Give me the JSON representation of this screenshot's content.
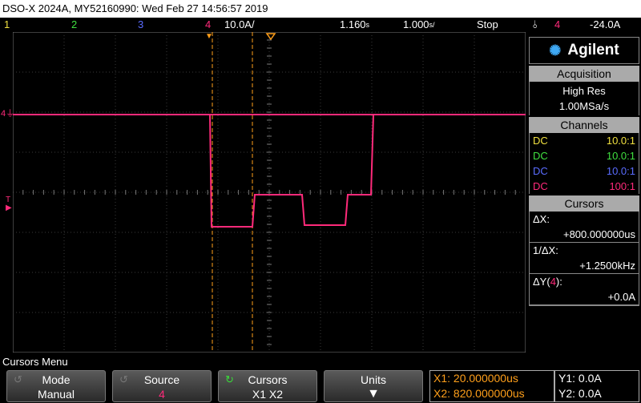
{
  "title": "DSO-X 2024A, MY52160990: Wed Feb 27 14:56:57 2019",
  "status": {
    "ch1": "1",
    "ch2": "2",
    "ch3": "3",
    "ch4": "4",
    "ch4_scale": "10.0A/",
    "time_delay": "1.160",
    "time_delay_unit": "s",
    "time_scale": "1.000",
    "time_scale_unit": "s/",
    "run_state": "Stop",
    "trigger_source": "4",
    "trigger_level": "-24.0A"
  },
  "colors": {
    "ch1": "#f0e040",
    "ch2": "#40e040",
    "ch3": "#5a6cff",
    "ch4": "#ff2a7a",
    "cursor": "#ff9f1a"
  },
  "screen": {
    "ground_marker": "4",
    "trigger_marker": "T"
  },
  "panel": {
    "brand": "Agilent",
    "brand_icon": "agilent-spark-icon",
    "acquisition_title": "Acquisition",
    "acq_mode": "High Res",
    "acq_rate": "1.00MSa/s",
    "channels_title": "Channels",
    "channels": [
      {
        "coupling": "DC",
        "probe": "10.0:1"
      },
      {
        "coupling": "DC",
        "probe": "10.0:1"
      },
      {
        "coupling": "DC",
        "probe": "10.0:1"
      },
      {
        "coupling": "DC",
        "probe": "100:1"
      }
    ],
    "cursors_title": "Cursors",
    "dx_label": "ΔX:",
    "dx_value": "+800.000000us",
    "inv_dx_label": "1/ΔX:",
    "inv_dx_value": "+1.2500kHz",
    "dy_label_pre": "ΔY(",
    "dy_label_ch": "4",
    "dy_label_post": "):",
    "dy_value": "+0.0A"
  },
  "menu": {
    "title": "Cursors Menu",
    "softkeys": [
      {
        "label": "Mode",
        "value": "Manual"
      },
      {
        "label": "Source",
        "value": "4"
      },
      {
        "label": "Cursors",
        "value": "X1 X2"
      },
      {
        "label": "Units",
        "value": ""
      }
    ],
    "x1": "X1: 20.000000us",
    "x2": "X2: 820.000000us",
    "y1": "Y1: 0.0A",
    "y2": "Y2: 0.0A"
  }
}
